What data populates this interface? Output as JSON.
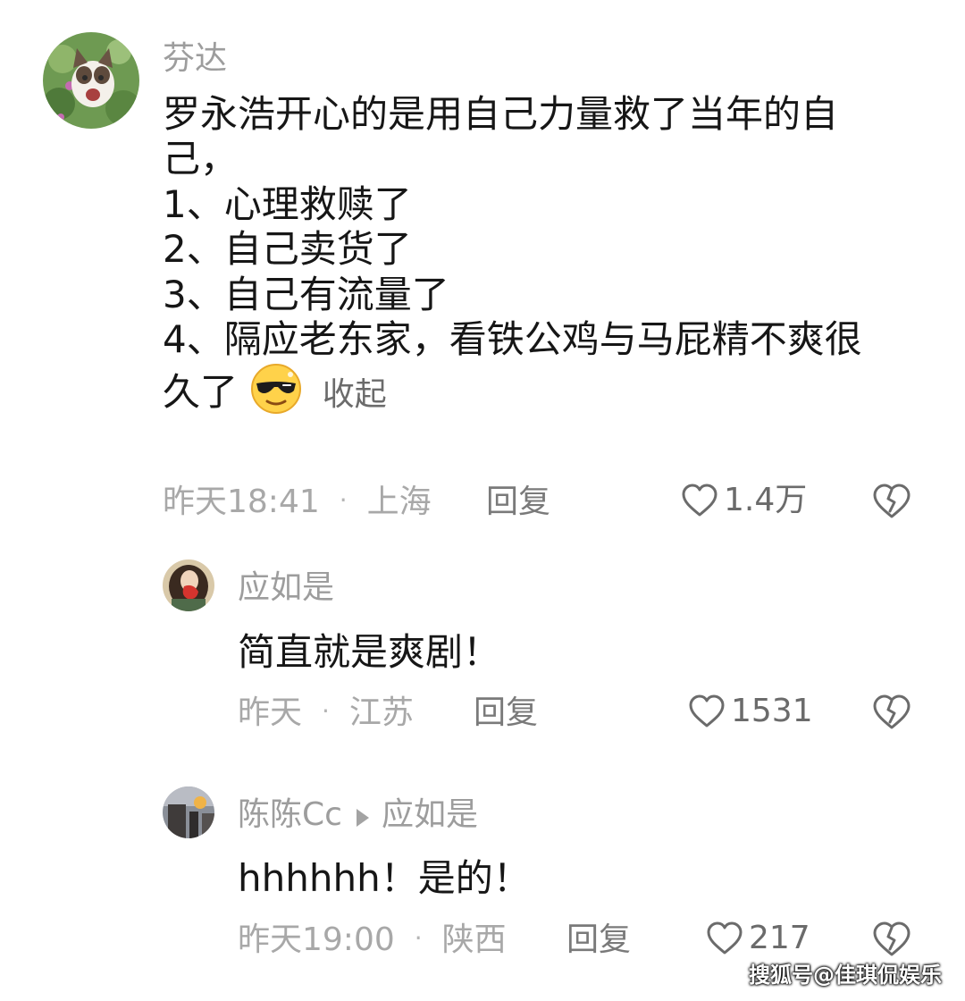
{
  "comments": [
    {
      "username": "芬达",
      "text_lines": [
        "罗永浩开心的是用自己力量救了当年的自",
        "己，",
        "1、心理救赎了",
        "2、自己卖货了",
        "3、自己有流量了",
        "4、隔应老东家，看铁公鸡与马屁精不爽很",
        "久了"
      ],
      "emoji": "cool-sunglasses-emoji",
      "collapse_label": "收起",
      "time": "昨天18:41",
      "location": "上海",
      "reply_label": "回复",
      "likes": "1.4万"
    },
    {
      "username": "应如是",
      "text": "简直就是爽剧！",
      "time": "昨天",
      "location": "江苏",
      "reply_label": "回复",
      "likes": "1531"
    },
    {
      "username": "陈陈Cc",
      "reply_to": "应如是",
      "text": "hhhhhh！是的！",
      "time": "昨天19:00",
      "location": "陕西",
      "reply_label": "回复",
      "likes": "217"
    }
  ],
  "separator": "·",
  "icons": {
    "like": "heart-outline-icon",
    "dislike": "broken-heart-icon",
    "reply_to": "triangle-right-icon"
  },
  "watermark": "搜狐号@佳琪侃娱乐"
}
